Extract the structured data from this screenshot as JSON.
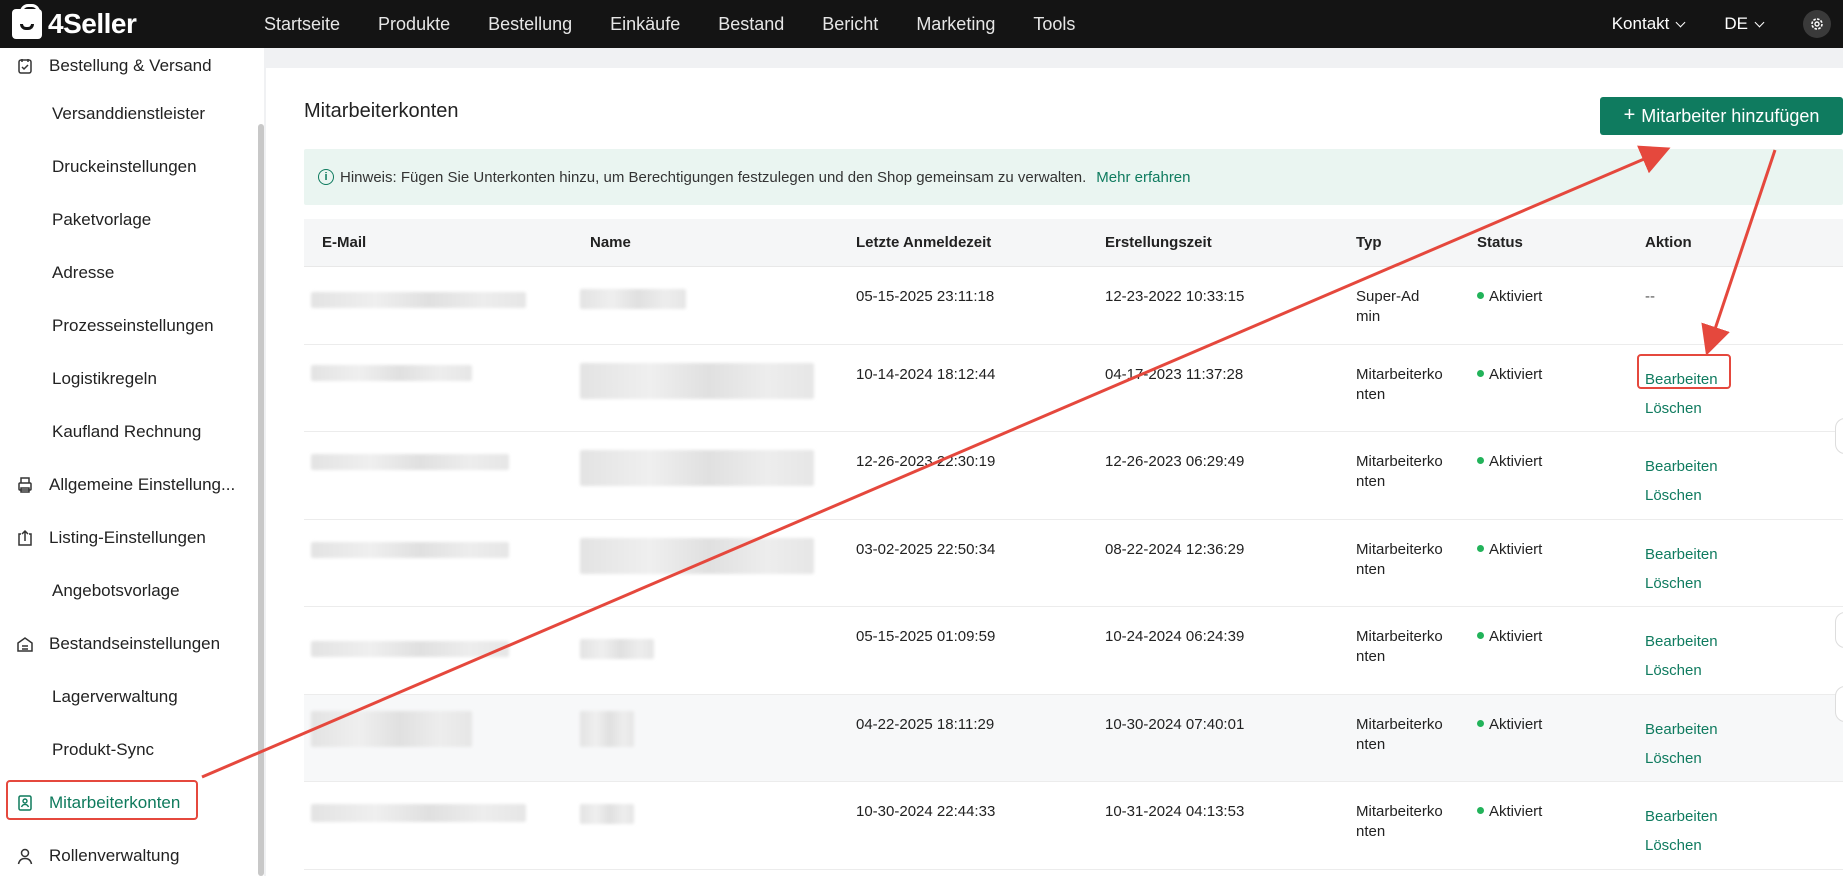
{
  "app": {
    "name": "4Seller"
  },
  "nav": [
    "Startseite",
    "Produkte",
    "Bestellung",
    "Einkäufe",
    "Bestand",
    "Bericht",
    "Marketing",
    "Tools"
  ],
  "topright": {
    "contact": "Kontakt",
    "lang": "DE"
  },
  "sidebar": {
    "items": [
      {
        "label": "Bestellung & Versand",
        "type": "group",
        "icon": "order-icon"
      },
      {
        "label": "Versanddienstleister",
        "type": "sub"
      },
      {
        "label": "Druckeinstellungen",
        "type": "sub"
      },
      {
        "label": "Paketvorlage",
        "type": "sub"
      },
      {
        "label": "Adresse",
        "type": "sub"
      },
      {
        "label": "Prozesseinstellungen",
        "type": "sub"
      },
      {
        "label": "Logistikregeln",
        "type": "sub"
      },
      {
        "label": "Kaufland Rechnung",
        "type": "sub"
      },
      {
        "label": "Allgemeine Einstellung...",
        "type": "group",
        "icon": "printer-icon"
      },
      {
        "label": "Listing-Einstellungen",
        "type": "group",
        "icon": "upload-icon"
      },
      {
        "label": "Angebotsvorlage",
        "type": "sub"
      },
      {
        "label": "Bestandseinstellungen",
        "type": "group",
        "icon": "inventory-icon"
      },
      {
        "label": "Lagerverwaltung",
        "type": "sub"
      },
      {
        "label": "Produkt-Sync",
        "type": "sub"
      },
      {
        "label": "Mitarbeiterkonten",
        "type": "group",
        "icon": "staff-badge-icon",
        "active": true
      },
      {
        "label": "Rollenverwaltung",
        "type": "group",
        "icon": "user-icon"
      }
    ]
  },
  "main": {
    "title": "Mitarbeiterkonten",
    "add_button": "Mitarbeiter hinzufügen",
    "hint": {
      "text": "Hinweis: Fügen Sie Unterkonten hinzu, um Berechtigungen festzulegen und den Shop gemeinsam zu verwalten.",
      "link": "Mehr erfahren"
    },
    "columns": [
      "E-Mail",
      "Name",
      "Letzte Anmeldezeit",
      "Erstellungszeit",
      "Typ",
      "Status",
      "Aktion"
    ],
    "rows": [
      {
        "last_login": "05-15-2025 23:11:18",
        "created": "12-23-2022 10:33:15",
        "type": "Super-Admin",
        "status": "Aktiviert",
        "actions": [
          "--"
        ]
      },
      {
        "last_login": "10-14-2024 18:12:44",
        "created": "04-17-2023 11:37:28",
        "type": "Mitarbeiterkonten",
        "status": "Aktiviert",
        "actions": [
          "Bearbeiten",
          "Löschen"
        ]
      },
      {
        "last_login": "12-26-2023 22:30:19",
        "created": "12-26-2023 06:29:49",
        "type": "Mitarbeiterkonten",
        "status": "Aktiviert",
        "actions": [
          "Bearbeiten",
          "Löschen"
        ]
      },
      {
        "last_login": "03-02-2025 22:50:34",
        "created": "08-22-2024 12:36:29",
        "type": "Mitarbeiterkonten",
        "status": "Aktiviert",
        "actions": [
          "Bearbeiten",
          "Löschen"
        ]
      },
      {
        "last_login": "05-15-2025 01:09:59",
        "created": "10-24-2024 06:24:39",
        "type": "Mitarbeiterkonten",
        "status": "Aktiviert",
        "actions": [
          "Bearbeiten",
          "Löschen"
        ]
      },
      {
        "last_login": "04-22-2025 18:11:29",
        "created": "10-30-2024 07:40:01",
        "type": "Mitarbeiterkonten",
        "status": "Aktiviert",
        "actions": [
          "Bearbeiten",
          "Löschen"
        ]
      },
      {
        "last_login": "10-30-2024 22:44:33",
        "created": "10-31-2024 04:13:53",
        "type": "Mitarbeiterkonten",
        "status": "Aktiviert",
        "actions": [
          "Bearbeiten",
          "Löschen"
        ]
      }
    ]
  },
  "colors": {
    "accent": "#0f7b5f",
    "annotation": "#e5483d",
    "status_active": "#22b35a"
  }
}
